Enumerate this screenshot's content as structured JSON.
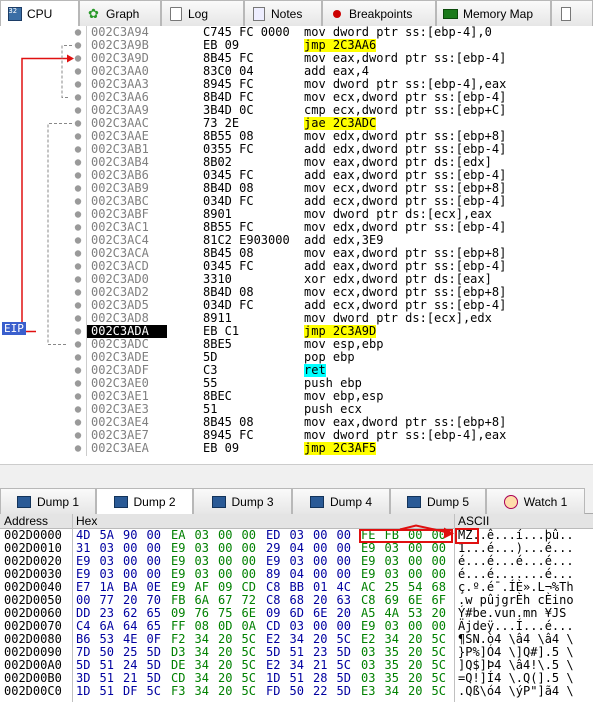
{
  "top_tabs": [
    {
      "label": "CPU",
      "icon": "cpu-icon",
      "active": true
    },
    {
      "label": "Graph",
      "icon": "graph-icon",
      "active": false
    },
    {
      "label": "Log",
      "icon": "log-icon",
      "active": false
    },
    {
      "label": "Notes",
      "icon": "notes-icon",
      "active": false
    },
    {
      "label": "Breakpoints",
      "icon": "breakpoint-icon",
      "active": false
    },
    {
      "label": "Memory Map",
      "icon": "memory-map-icon",
      "active": false
    }
  ],
  "eip_label": "EIP",
  "disasm": [
    {
      "addr": "002C3A94",
      "bytes": "C745 FC 0000",
      "ins": "mov dword ptr ss:[ebp-4],0"
    },
    {
      "addr": "002C3A9B",
      "bytes": "EB 09",
      "ins": "jmp 2C3AA6",
      "jump": true
    },
    {
      "addr": "002C3A9D",
      "bytes": "8B45 FC",
      "ins": "mov eax,dword ptr ss:[ebp-4]"
    },
    {
      "addr": "002C3AA0",
      "bytes": "83C0 04",
      "ins": "add eax,4"
    },
    {
      "addr": "002C3AA3",
      "bytes": "8945 FC",
      "ins": "mov dword ptr ss:[ebp-4],eax"
    },
    {
      "addr": "002C3AA6",
      "bytes": "8B4D FC",
      "ins": "mov ecx,dword ptr ss:[ebp-4]"
    },
    {
      "addr": "002C3AA9",
      "bytes": "3B4D 0C",
      "ins": "cmp ecx,dword ptr ss:[ebp+C]"
    },
    {
      "addr": "002C3AAC",
      "bytes": "73 2E",
      "ins": "jae 2C3ADC",
      "jump": true
    },
    {
      "addr": "002C3AAE",
      "bytes": "8B55 08",
      "ins": "mov edx,dword ptr ss:[ebp+8]"
    },
    {
      "addr": "002C3AB1",
      "bytes": "0355 FC",
      "ins": "add edx,dword ptr ss:[ebp-4]"
    },
    {
      "addr": "002C3AB4",
      "bytes": "8B02",
      "ins": "mov eax,dword ptr ds:[edx]"
    },
    {
      "addr": "002C3AB6",
      "bytes": "0345 FC",
      "ins": "add eax,dword ptr ss:[ebp-4]"
    },
    {
      "addr": "002C3AB9",
      "bytes": "8B4D 08",
      "ins": "mov ecx,dword ptr ss:[ebp+8]"
    },
    {
      "addr": "002C3ABC",
      "bytes": "034D FC",
      "ins": "add ecx,dword ptr ss:[ebp-4]"
    },
    {
      "addr": "002C3ABF",
      "bytes": "8901",
      "ins": "mov dword ptr ds:[ecx],eax"
    },
    {
      "addr": "002C3AC1",
      "bytes": "8B55 FC",
      "ins": "mov edx,dword ptr ss:[ebp-4]"
    },
    {
      "addr": "002C3AC4",
      "bytes": "81C2 E903000",
      "ins": "add edx,3E9"
    },
    {
      "addr": "002C3ACA",
      "bytes": "8B45 08",
      "ins": "mov eax,dword ptr ss:[ebp+8]"
    },
    {
      "addr": "002C3ACD",
      "bytes": "0345 FC",
      "ins": "add eax,dword ptr ss:[ebp-4]"
    },
    {
      "addr": "002C3AD0",
      "bytes": "3310",
      "ins": "xor edx,dword ptr ds:[eax]"
    },
    {
      "addr": "002C3AD2",
      "bytes": "8B4D 08",
      "ins": "mov ecx,dword ptr ss:[ebp+8]"
    },
    {
      "addr": "002C3AD5",
      "bytes": "034D FC",
      "ins": "add ecx,dword ptr ss:[ebp-4]"
    },
    {
      "addr": "002C3AD8",
      "bytes": "8911",
      "ins": "mov dword ptr ds:[ecx],edx"
    },
    {
      "addr": "002C3ADA",
      "bytes": "EB C1",
      "ins": "jmp 2C3A9D",
      "jump": true,
      "eip": true
    },
    {
      "addr": "002C3ADC",
      "bytes": "8BE5",
      "ins": "mov esp,ebp"
    },
    {
      "addr": "002C3ADE",
      "bytes": "5D",
      "ins": "pop ebp"
    },
    {
      "addr": "002C3ADF",
      "bytes": "C3",
      "ins": "ret",
      "ret": true
    },
    {
      "addr": "002C3AE0",
      "bytes": "55",
      "ins": "push ebp"
    },
    {
      "addr": "002C3AE1",
      "bytes": "8BEC",
      "ins": "mov ebp,esp"
    },
    {
      "addr": "002C3AE3",
      "bytes": "51",
      "ins": "push ecx"
    },
    {
      "addr": "002C3AE4",
      "bytes": "8B45 08",
      "ins": "mov eax,dword ptr ss:[ebp+8]"
    },
    {
      "addr": "002C3AE7",
      "bytes": "8945 FC",
      "ins": "mov dword ptr ss:[ebp-4],eax"
    },
    {
      "addr": "002C3AEA",
      "bytes": "EB 09",
      "ins": "jmp 2C3AF5",
      "jump": true
    }
  ],
  "dump_tabs": [
    {
      "label": "Dump 1",
      "icon": "dump-icon",
      "active": false
    },
    {
      "label": "Dump 2",
      "icon": "dump-icon",
      "active": true
    },
    {
      "label": "Dump 3",
      "icon": "dump-icon",
      "active": false
    },
    {
      "label": "Dump 4",
      "icon": "dump-icon",
      "active": false
    },
    {
      "label": "Dump 5",
      "icon": "dump-icon",
      "active": false
    },
    {
      "label": "Watch 1",
      "icon": "watch-icon",
      "active": false
    }
  ],
  "dump_headers": {
    "address": "Address",
    "hex": "Hex",
    "ascii": "ASCII"
  },
  "dump": [
    {
      "addr": "002D0000",
      "hex": [
        "4D",
        "5A",
        "90",
        "00",
        "EA",
        "03",
        "00",
        "00",
        "ED",
        "03",
        "00",
        "00",
        "FE",
        "FB",
        "00",
        "00"
      ],
      "ascii": "MZ..ê...í...þû.."
    },
    {
      "addr": "002D0010",
      "hex": [
        "31",
        "03",
        "00",
        "00",
        "E9",
        "03",
        "00",
        "00",
        "29",
        "04",
        "00",
        "00",
        "E9",
        "03",
        "00",
        "00"
      ],
      "ascii": "1...é...)...é..."
    },
    {
      "addr": "002D0020",
      "hex": [
        "E9",
        "03",
        "00",
        "00",
        "E9",
        "03",
        "00",
        "00",
        "E9",
        "03",
        "00",
        "00",
        "E9",
        "03",
        "00",
        "00"
      ],
      "ascii": "é...é...é...é..."
    },
    {
      "addr": "002D0030",
      "hex": [
        "E9",
        "03",
        "00",
        "00",
        "E9",
        "03",
        "00",
        "00",
        "89",
        "04",
        "00",
        "00",
        "E9",
        "03",
        "00",
        "00"
      ],
      "ascii": "é...é.......é..."
    },
    {
      "addr": "002D0040",
      "hex": [
        "E7",
        "1A",
        "BA",
        "0E",
        "E9",
        "AF",
        "09",
        "CD",
        "C8",
        "BB",
        "01",
        "4C",
        "AC",
        "25",
        "54",
        "68"
      ],
      "ascii": "ç.º.é¯.ÍÈ».L¬%Th"
    },
    {
      "addr": "002D0050",
      "hex": [
        "00",
        "77",
        "20",
        "70",
        "FB",
        "6A",
        "67",
        "72",
        "C8",
        "68",
        "20",
        "63",
        "C8",
        "69",
        "6E",
        "6F"
      ],
      "ascii": ".w pûjgrÈh cÈino"
    },
    {
      "addr": "002D0060",
      "hex": [
        "DD",
        "23",
        "62",
        "65",
        "09",
        "76",
        "75",
        "6E",
        "09",
        "6D",
        "6E",
        "20",
        "A5",
        "4A",
        "53",
        "20"
      ],
      "ascii": "Ý#be.vun.mn ¥JS "
    },
    {
      "addr": "002D0070",
      "hex": [
        "C4",
        "6A",
        "64",
        "65",
        "FF",
        "08",
        "0D",
        "0A",
        "CD",
        "03",
        "00",
        "00",
        "E9",
        "03",
        "00",
        "00"
      ],
      "ascii": "Äjdeÿ...Í...é..."
    },
    {
      "addr": "002D0080",
      "hex": [
        "B6",
        "53",
        "4E",
        "0F",
        "F2",
        "34",
        "20",
        "5C",
        "E2",
        "34",
        "20",
        "5C",
        "E2",
        "34",
        "20",
        "5C"
      ],
      "ascii": "¶SN.ò4 \\â4 \\â4 \\"
    },
    {
      "addr": "002D0090",
      "hex": [
        "7D",
        "50",
        "25",
        "5D",
        "D3",
        "34",
        "20",
        "5C",
        "5D",
        "51",
        "23",
        "5D",
        "03",
        "35",
        "20",
        "5C"
      ],
      "ascii": "}P%]Ó4 \\]Q#].5 \\"
    },
    {
      "addr": "002D00A0",
      "hex": [
        "5D",
        "51",
        "24",
        "5D",
        "DE",
        "34",
        "20",
        "5C",
        "E2",
        "34",
        "21",
        "5C",
        "03",
        "35",
        "20",
        "5C"
      ],
      "ascii": "]Q$]Þ4 \\â4!\\.5 \\"
    },
    {
      "addr": "002D00B0",
      "hex": [
        "3D",
        "51",
        "21",
        "5D",
        "CD",
        "34",
        "20",
        "5C",
        "1D",
        "51",
        "28",
        "5D",
        "03",
        "35",
        "20",
        "5C"
      ],
      "ascii": "=Q!]Í4 \\.Q(].5 \\"
    },
    {
      "addr": "002D00C0",
      "hex": [
        "1D",
        "51",
        "DF",
        "5C",
        "F3",
        "34",
        "20",
        "5C",
        "FD",
        "50",
        "22",
        "5D",
        "E3",
        "34",
        "20",
        "5C"
      ],
      "ascii": ".Qß\\ó4 \\ýP\"]ã4 \\"
    }
  ],
  "colors": {
    "eip_flag": "#3a5fcd",
    "jump_highlight": "#ffff00",
    "arrow": "#e01010",
    "hex_blue": "#0000a0",
    "hex_green": "#008000"
  }
}
